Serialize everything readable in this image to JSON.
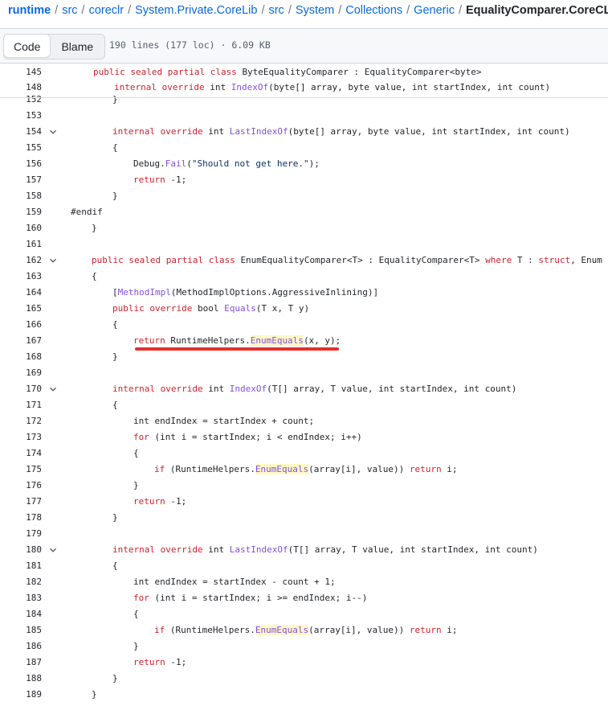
{
  "breadcrumb": {
    "segments": [
      "runtime",
      "src",
      "coreclr",
      "System.Private.CoreLib",
      "src",
      "System",
      "Collections",
      "Generic"
    ],
    "separator": "/",
    "current": "EqualityComparer.CoreCLR.cs"
  },
  "toolbar": {
    "tab_code": "Code",
    "tab_blame": "Blame",
    "file_info": "190 lines (177 loc) · 6.09 KB"
  },
  "colors": {
    "keyword": "#cf222e",
    "function": "#8250df",
    "type": "#953800",
    "string": "#0a3069",
    "highlight": "#fff8c5",
    "annotation_underline": "#e5312b"
  },
  "icons": {
    "fold": "chevron-down-icon"
  },
  "sticky_lines": [
    {
      "num": "145",
      "tokens": [
        [
          "kw",
          "public sealed partial class "
        ],
        [
          "",
          "ByteEqualityComparer : EqualityComparer<byte>"
        ]
      ]
    },
    {
      "num": "148",
      "tokens": [
        [
          "kw",
          "internal override "
        ],
        [
          "",
          "int "
        ],
        [
          "fn",
          "IndexOf"
        ],
        [
          "",
          "(byte[] array, byte value, int startIndex, int count)"
        ]
      ]
    }
  ],
  "lines": [
    {
      "num": "152",
      "tokens": [
        [
          "",
          "}"
        ]
      ]
    },
    {
      "num": "153",
      "tokens": []
    },
    {
      "num": "154",
      "fold": true,
      "tokens": [
        [
          "kw",
          "internal override "
        ],
        [
          "",
          "int "
        ],
        [
          "fn",
          "LastIndexOf"
        ],
        [
          "",
          "(byte[] array, byte value, int startIndex, int count)"
        ]
      ]
    },
    {
      "num": "155",
      "tokens": [
        [
          "",
          "{"
        ]
      ]
    },
    {
      "num": "156",
      "tokens": [
        [
          "",
          "Debug."
        ],
        [
          "fn",
          "Fail"
        ],
        [
          "",
          "("
        ],
        [
          "st",
          "\"Should not get here.\""
        ],
        [
          "",
          ");"
        ]
      ]
    },
    {
      "num": "157",
      "tokens": [
        [
          "kw",
          "return "
        ],
        [
          "",
          "-1;"
        ]
      ]
    },
    {
      "num": "158",
      "tokens": [
        [
          "",
          "}"
        ]
      ]
    },
    {
      "num": "159",
      "tokens": [
        [
          "",
          "#endif"
        ]
      ]
    },
    {
      "num": "160",
      "tokens": [
        [
          "",
          "}"
        ]
      ]
    },
    {
      "num": "161",
      "tokens": []
    },
    {
      "num": "162",
      "fold": true,
      "tokens": [
        [
          "kw",
          "public sealed partial class "
        ],
        [
          "",
          "EnumEqualityComparer<T> : EqualityComparer<T> "
        ],
        [
          "kw",
          "where "
        ],
        [
          "",
          "T : "
        ],
        [
          "kw",
          "struct"
        ],
        [
          "",
          ", Enum"
        ]
      ]
    },
    {
      "num": "163",
      "tokens": [
        [
          "",
          "{"
        ]
      ]
    },
    {
      "num": "164",
      "tokens": [
        [
          "",
          "["
        ],
        [
          "fn",
          "MethodImpl"
        ],
        [
          "",
          "(MethodImplOptions.AggressiveInlining)]"
        ]
      ]
    },
    {
      "num": "165",
      "tokens": [
        [
          "kw",
          "public override "
        ],
        [
          "",
          "bool "
        ],
        [
          "fn",
          "Equals"
        ],
        [
          "",
          "(T x, T y)"
        ]
      ]
    },
    {
      "num": "166",
      "tokens": [
        [
          "",
          "{"
        ]
      ]
    },
    {
      "num": "167",
      "tokens": [
        [
          "kw",
          "return "
        ],
        [
          "",
          "RuntimeHelpers."
        ],
        [
          "fn hl",
          "EnumEquals"
        ],
        [
          "",
          "(x, y);"
        ]
      ]
    },
    {
      "num": "168",
      "tokens": [
        [
          "",
          "}"
        ]
      ]
    },
    {
      "num": "169",
      "tokens": []
    },
    {
      "num": "170",
      "fold": true,
      "tokens": [
        [
          "kw",
          "internal override "
        ],
        [
          "",
          "int "
        ],
        [
          "fn",
          "IndexOf"
        ],
        [
          "",
          "(T[] array, T value, int startIndex, int count)"
        ]
      ]
    },
    {
      "num": "171",
      "tokens": [
        [
          "",
          "{"
        ]
      ]
    },
    {
      "num": "172",
      "tokens": [
        [
          "",
          "int endIndex = startIndex + count;"
        ]
      ]
    },
    {
      "num": "173",
      "tokens": [
        [
          "kw",
          "for "
        ],
        [
          "",
          "(int i = startIndex; i < endIndex; i++)"
        ]
      ]
    },
    {
      "num": "174",
      "tokens": [
        [
          "",
          "{"
        ]
      ]
    },
    {
      "num": "175",
      "tokens": [
        [
          "kw",
          "if "
        ],
        [
          "",
          "(RuntimeHelpers."
        ],
        [
          "fn hl",
          "EnumEquals"
        ],
        [
          "",
          "(array[i], value)) "
        ],
        [
          "kw",
          "return "
        ],
        [
          "",
          "i;"
        ]
      ]
    },
    {
      "num": "176",
      "tokens": [
        [
          "",
          "}"
        ]
      ]
    },
    {
      "num": "177",
      "tokens": [
        [
          "kw",
          "return "
        ],
        [
          "",
          "-1;"
        ]
      ]
    },
    {
      "num": "178",
      "tokens": [
        [
          "",
          "}"
        ]
      ]
    },
    {
      "num": "179",
      "tokens": []
    },
    {
      "num": "180",
      "fold": true,
      "tokens": [
        [
          "kw",
          "internal override "
        ],
        [
          "",
          "int "
        ],
        [
          "fn",
          "LastIndexOf"
        ],
        [
          "",
          "(T[] array, T value, int startIndex, int count)"
        ]
      ]
    },
    {
      "num": "181",
      "tokens": [
        [
          "",
          "{"
        ]
      ]
    },
    {
      "num": "182",
      "tokens": [
        [
          "",
          "int endIndex = startIndex - count + 1;"
        ]
      ]
    },
    {
      "num": "183",
      "tokens": [
        [
          "kw",
          "for "
        ],
        [
          "",
          "(int i = startIndex; i >= endIndex; i--)"
        ]
      ]
    },
    {
      "num": "184",
      "tokens": [
        [
          "",
          "{"
        ]
      ]
    },
    {
      "num": "185",
      "tokens": [
        [
          "kw",
          "if "
        ],
        [
          "",
          "(RuntimeHelpers."
        ],
        [
          "fn hl",
          "EnumEquals"
        ],
        [
          "",
          "(array[i], value)) "
        ],
        [
          "kw",
          "return "
        ],
        [
          "",
          "i;"
        ]
      ]
    },
    {
      "num": "186",
      "tokens": [
        [
          "",
          "}"
        ]
      ]
    },
    {
      "num": "187",
      "tokens": [
        [
          "kw",
          "return "
        ],
        [
          "",
          "-1;"
        ]
      ]
    },
    {
      "num": "188",
      "tokens": [
        [
          "",
          "}"
        ]
      ]
    },
    {
      "num": "189",
      "tokens": [
        [
          "",
          "}"
        ]
      ]
    }
  ]
}
